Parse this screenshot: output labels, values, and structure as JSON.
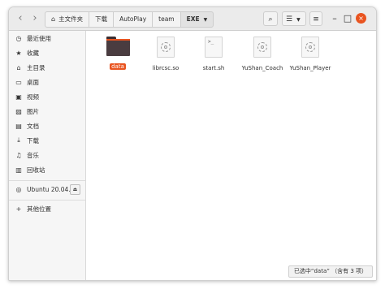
{
  "breadcrumb": [
    "主文件夹",
    "下载",
    "AutoPlay",
    "team",
    "EXE"
  ],
  "window_controls": {
    "minimize": "–",
    "maximize": "□",
    "close": "×"
  },
  "sidebar": {
    "items": [
      {
        "icon": "clock-icon",
        "glyph": "◷",
        "label": "最近使用"
      },
      {
        "icon": "star-icon",
        "glyph": "★",
        "label": "收藏"
      },
      {
        "icon": "home-icon",
        "glyph": "⌂",
        "label": "主目录"
      },
      {
        "icon": "desktop-icon",
        "glyph": "▭",
        "label": "桌面"
      },
      {
        "icon": "video-icon",
        "glyph": "▣",
        "label": "视频"
      },
      {
        "icon": "image-icon",
        "glyph": "▨",
        "label": "图片"
      },
      {
        "icon": "document-icon",
        "glyph": "▤",
        "label": "文档"
      },
      {
        "icon": "download-icon",
        "glyph": "⤓",
        "label": "下载"
      },
      {
        "icon": "music-icon",
        "glyph": "♫",
        "label": "音乐"
      },
      {
        "icon": "trash-icon",
        "glyph": "▥",
        "label": "回收站"
      }
    ],
    "device": {
      "icon": "disc-icon",
      "glyph": "◎",
      "label": "Ubuntu 20.04...",
      "eject_glyph": "⏏"
    },
    "other": {
      "icon": "plus-icon",
      "glyph": "+",
      "label": "其他位置"
    }
  },
  "files": [
    {
      "name": "data",
      "type": "folder",
      "selected": true
    },
    {
      "name": "librcsc.so",
      "type": "library",
      "selected": false
    },
    {
      "name": "start.sh",
      "type": "script",
      "selected": false
    },
    {
      "name": "YuShan_Coach",
      "type": "executable",
      "selected": false
    },
    {
      "name": "YuShan_Player",
      "type": "executable",
      "selected": false
    }
  ],
  "status": "已选中“data” （含有 3 项）",
  "colors": {
    "accent": "#e95420",
    "folder": "#4a3c40",
    "header": "#ebebeb",
    "sidebar": "#f6f6f6"
  }
}
